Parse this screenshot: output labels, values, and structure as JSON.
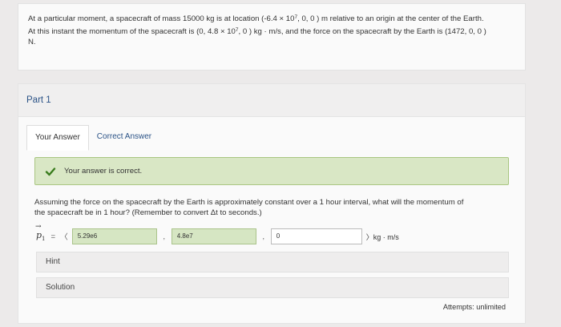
{
  "problem": {
    "line1_a": "At a particular moment, a spacecraft of mass 15000 kg is at location (-6.4 × 10",
    "line1_exp": "7",
    "line1_b": ", 0, 0 ) m relative to an origin at the center of the Earth.",
    "line2_a": "At this instant the momentum of the spacecraft is (0, 4.8 × 10",
    "line2_exp": "7",
    "line2_b": ", 0 ) kg · m/s, and the force on the spacecraft by the Earth is (1472, 0, 0 )",
    "line3": "N."
  },
  "part": {
    "title": "Part 1"
  },
  "tabs": [
    {
      "label": "Your Answer",
      "active": true
    },
    {
      "label": "Correct Answer",
      "active": false
    }
  ],
  "feedback": {
    "text": "Your answer is correct."
  },
  "question": {
    "text_a": "Assuming the force on the spacecraft by the Earth is approximately constant over a 1 hour interval, what will the momentum of",
    "text_b": "the spacecraft be in 1 hour? (Remember to convert Δt to seconds.)"
  },
  "answer": {
    "symbol": "p",
    "subscript": "1",
    "equals": "=",
    "open_bracket": "〈",
    "x_value": "5.29e6",
    "y_value": "4.8e7",
    "z_value": "0",
    "separator": ",",
    "close_units": "〉kg · m/s"
  },
  "hint": {
    "label": "Hint"
  },
  "solution": {
    "label": "Solution"
  },
  "attempts": {
    "text": "Attempts: unlimited"
  },
  "colors": {
    "accent": "#2a5286",
    "correct_bg": "#d9e7c5",
    "correct_border": "#a9c681",
    "check": "#3a7d1e"
  }
}
